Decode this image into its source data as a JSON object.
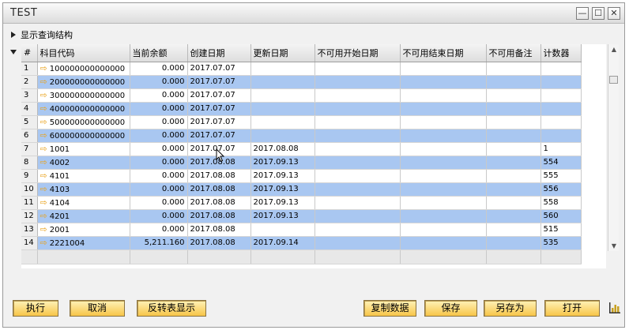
{
  "window": {
    "title": "TEST",
    "controls": {
      "minimize": "—",
      "maximize": "☐",
      "close": "✕"
    }
  },
  "toggle_label": "显示查询结构",
  "grid": {
    "columns": [
      "#",
      "科目代码",
      "当前余额",
      "创建日期",
      "更新日期",
      "不可用开始日期",
      "不可用结束日期",
      "不可用备注",
      "计数器"
    ],
    "rows": [
      {
        "n": "1",
        "code": "100000000000000",
        "balance": "0.000",
        "created": "2017.07.07",
        "updated": "",
        "from": "",
        "to": "",
        "note": "",
        "counter": ""
      },
      {
        "n": "2",
        "code": "200000000000000",
        "balance": "0.000",
        "created": "2017.07.07",
        "updated": "",
        "from": "",
        "to": "",
        "note": "",
        "counter": ""
      },
      {
        "n": "3",
        "code": "300000000000000",
        "balance": "0.000",
        "created": "2017.07.07",
        "updated": "",
        "from": "",
        "to": "",
        "note": "",
        "counter": ""
      },
      {
        "n": "4",
        "code": "400000000000000",
        "balance": "0.000",
        "created": "2017.07.07",
        "updated": "",
        "from": "",
        "to": "",
        "note": "",
        "counter": ""
      },
      {
        "n": "5",
        "code": "500000000000000",
        "balance": "0.000",
        "created": "2017.07.07",
        "updated": "",
        "from": "",
        "to": "",
        "note": "",
        "counter": ""
      },
      {
        "n": "6",
        "code": "600000000000000",
        "balance": "0.000",
        "created": "2017.07.07",
        "updated": "",
        "from": "",
        "to": "",
        "note": "",
        "counter": ""
      },
      {
        "n": "7",
        "code": "1001",
        "balance": "0.000",
        "created": "2017.07.07",
        "updated": "2017.08.08",
        "from": "",
        "to": "",
        "note": "",
        "counter": "1"
      },
      {
        "n": "8",
        "code": "4002",
        "balance": "0.000",
        "created": "2017.08.08",
        "updated": "2017.09.13",
        "from": "",
        "to": "",
        "note": "",
        "counter": "554"
      },
      {
        "n": "9",
        "code": "4101",
        "balance": "0.000",
        "created": "2017.08.08",
        "updated": "2017.09.13",
        "from": "",
        "to": "",
        "note": "",
        "counter": "555"
      },
      {
        "n": "10",
        "code": "4103",
        "balance": "0.000",
        "created": "2017.08.08",
        "updated": "2017.09.13",
        "from": "",
        "to": "",
        "note": "",
        "counter": "556"
      },
      {
        "n": "11",
        "code": "4104",
        "balance": "0.000",
        "created": "2017.08.08",
        "updated": "2017.09.13",
        "from": "",
        "to": "",
        "note": "",
        "counter": "558"
      },
      {
        "n": "12",
        "code": "4201",
        "balance": "0.000",
        "created": "2017.08.08",
        "updated": "2017.09.13",
        "from": "",
        "to": "",
        "note": "",
        "counter": "560"
      },
      {
        "n": "13",
        "code": "2001",
        "balance": "0.000",
        "created": "2017.08.08",
        "updated": "",
        "from": "",
        "to": "",
        "note": "",
        "counter": "515"
      },
      {
        "n": "14",
        "code": "2221004",
        "balance": "5,211.160",
        "created": "2017.08.08",
        "updated": "2017.09.14",
        "from": "",
        "to": "",
        "note": "",
        "counter": "535"
      }
    ]
  },
  "buttons": {
    "execute": "执行",
    "cancel": "取消",
    "pivot": "反转表显示",
    "copy": "复制数据",
    "save": "保存",
    "save_as": "另存为",
    "open": "打开"
  },
  "colors": {
    "row_alt": "#a9c7f1",
    "button": "#f7c548",
    "link_arrow": "#e9a31d"
  },
  "icons": {
    "link_arrow": "⇨",
    "expand": "↗"
  }
}
